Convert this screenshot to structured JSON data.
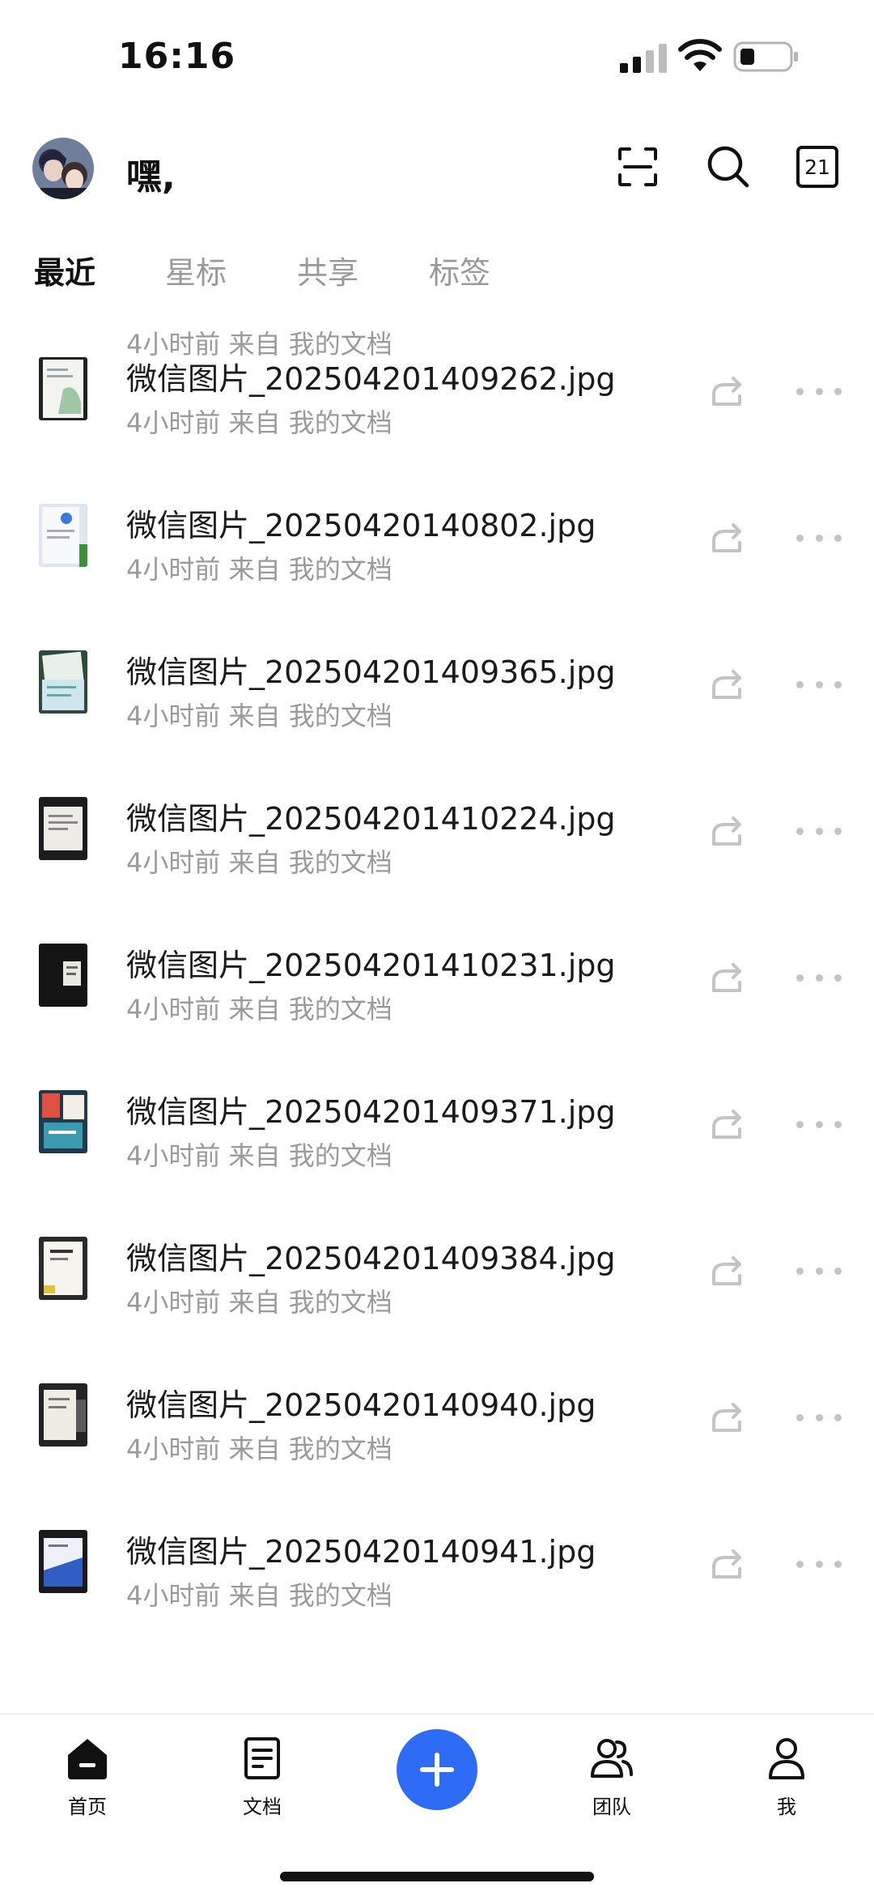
{
  "status_bar": {
    "time": "16:16"
  },
  "header": {
    "greeting": "嘿,",
    "calendar_day": "21"
  },
  "tabs": [
    {
      "label": "最近",
      "active": true
    },
    {
      "label": "星标",
      "active": false
    },
    {
      "label": "共享",
      "active": false
    },
    {
      "label": "标签",
      "active": false
    }
  ],
  "files": [
    {
      "name": "",
      "meta": "4小时前 来自 我的文档"
    },
    {
      "name": "微信图片_202504201409262.jpg",
      "meta": "4小时前 来自 我的文档"
    },
    {
      "name": "微信图片_20250420140802.jpg",
      "meta": "4小时前 来自 我的文档"
    },
    {
      "name": "微信图片_202504201409365.jpg",
      "meta": "4小时前 来自 我的文档"
    },
    {
      "name": "微信图片_202504201410224.jpg",
      "meta": "4小时前 来自 我的文档"
    },
    {
      "name": "微信图片_202504201410231.jpg",
      "meta": "4小时前 来自 我的文档"
    },
    {
      "name": "微信图片_202504201409371.jpg",
      "meta": "4小时前 来自 我的文档"
    },
    {
      "name": "微信图片_202504201409384.jpg",
      "meta": "4小时前 来自 我的文档"
    },
    {
      "name": "微信图片_20250420140940.jpg",
      "meta": "4小时前 来自 我的文档"
    },
    {
      "name": "微信图片_20250420140941.jpg",
      "meta": "4小时前 来自 我的文档"
    }
  ],
  "bottom_nav": {
    "home": "首页",
    "docs": "文档",
    "team": "团队",
    "me": "我"
  },
  "colors": {
    "accent": "#2f6cf6",
    "text_primary": "#1a1a1a",
    "text_secondary": "#9a9a9a",
    "icon_muted": "#c4c4c4"
  }
}
